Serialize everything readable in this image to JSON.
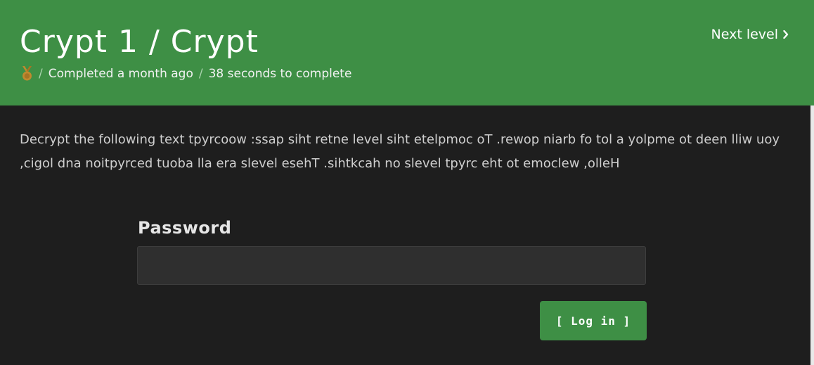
{
  "header": {
    "title": "Crypt 1 / Crypt",
    "completed": "Completed a month ago",
    "duration": "38 seconds to complete",
    "separator": "/",
    "medal_icon": "medal-icon",
    "next_level": "Next level",
    "next_icon": "chevron-right-icon"
  },
  "main": {
    "description": "Decrypt the following text tpyrcoow :ssap siht retne level siht etelpmoc oT .rewop niarb fo tol a yolpme ot deen lliw uoy ,cigol dna noitpyrced tuoba lla era slevel esehT .sihtkcah no slevel tpyrc eht ot emoclew ,olleH"
  },
  "form": {
    "password_label": "Password",
    "password_value": "",
    "login_button": "[ Log in ]"
  },
  "colors": {
    "accent": "#3e8f45",
    "background": "#1e1e1e",
    "input_background": "#2f2f2f",
    "medal": "#c08a2e"
  }
}
